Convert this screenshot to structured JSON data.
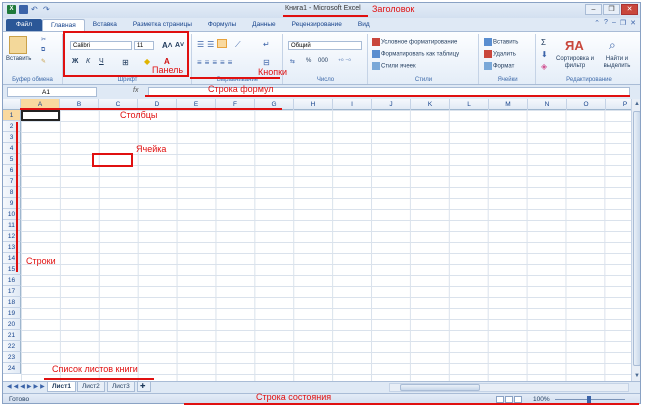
{
  "window": {
    "title": "Книга1 - Microsoft Excel",
    "app_icon": "X",
    "controls": [
      "–",
      "❐",
      "✕"
    ]
  },
  "tabs": {
    "file": "Файл",
    "items": [
      "Главная",
      "Вставка",
      "Разметка страницы",
      "Формулы",
      "Данные",
      "Рецензирование",
      "Вид"
    ]
  },
  "ribbon": {
    "clipboard": {
      "paste": "Вставить",
      "label": "Буфер обмена"
    },
    "font": {
      "name": "Calibri",
      "size": "11",
      "bold": "Ж",
      "italic": "К",
      "underline": "Ч",
      "label": "Шрифт"
    },
    "alignment": {
      "label": "Выравнивание"
    },
    "number": {
      "format": "Общий",
      "percent": "%",
      "thousands": "000",
      "label": "Число"
    },
    "styles": {
      "conditional": "Условное форматирование",
      "as_table": "Форматировать как таблицу",
      "cell_styles": "Стили ячеек",
      "label": "Стили"
    },
    "cells": {
      "insert": "Вставить",
      "delete": "Удалить",
      "format": "Формат",
      "label": "Ячейки"
    },
    "editing": {
      "sum": "Σ",
      "sort": "Сортировка и фильтр",
      "find": "Найти и выделить",
      "label": "Редактирование"
    }
  },
  "formula_bar": {
    "name_box": "A1",
    "fx": "fx"
  },
  "grid": {
    "columns": [
      "A",
      "B",
      "C",
      "D",
      "E",
      "F",
      "G",
      "H",
      "I",
      "J",
      "K",
      "L",
      "M",
      "N",
      "O",
      "P",
      "Q"
    ],
    "rows": [
      "1",
      "2",
      "3",
      "4",
      "5",
      "6",
      "7",
      "8",
      "9",
      "10",
      "11",
      "12",
      "13",
      "14",
      "15",
      "16",
      "17",
      "18",
      "19",
      "20",
      "21",
      "22",
      "23",
      "24"
    ],
    "selected_cell": "A1"
  },
  "sheets": [
    "Лист1",
    "Лист2",
    "Лист3"
  ],
  "status": {
    "ready": "Готово",
    "zoom": "100%"
  },
  "annotations": {
    "title": "Заголовок",
    "panel": "Панель",
    "buttons": "Кнопки",
    "formula": "Строка формул",
    "columns": "Столбцы",
    "cell": "Ячейка",
    "rows": "Строки",
    "sheets": "Список листов книги",
    "status": "Строка состояния"
  },
  "colors": {
    "annotation": "#e01010",
    "file_tab": "#2b5797",
    "selection": "#f9d99f"
  }
}
